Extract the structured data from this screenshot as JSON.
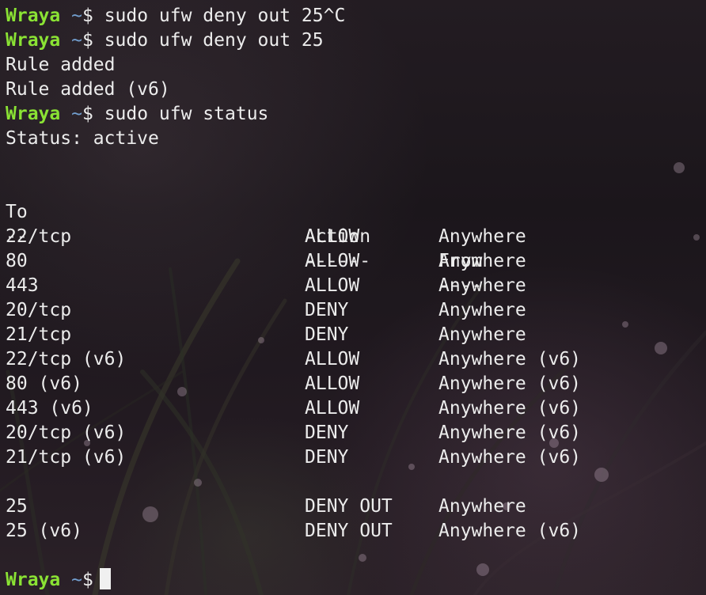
{
  "prompt": {
    "user": "Wraya",
    "path": "~",
    "symbol": "$"
  },
  "history": [
    {
      "type": "command",
      "text": "sudo ufw deny out 25^C"
    },
    {
      "type": "command",
      "text": "sudo ufw deny out 25"
    },
    {
      "type": "output",
      "text": "Rule added"
    },
    {
      "type": "output",
      "text": "Rule added (v6)"
    },
    {
      "type": "command",
      "text": "sudo ufw status"
    },
    {
      "type": "output",
      "text": "Status: active"
    }
  ],
  "table": {
    "headers": [
      "To",
      "Action",
      "From"
    ],
    "separators": [
      "--",
      "------",
      "----"
    ],
    "rules": [
      [
        "22/tcp",
        "ALLOW",
        "Anywhere"
      ],
      [
        "80",
        "ALLOW",
        "Anywhere"
      ],
      [
        "443",
        "ALLOW",
        "Anywhere"
      ],
      [
        "20/tcp",
        "DENY",
        "Anywhere"
      ],
      [
        "21/tcp",
        "DENY",
        "Anywhere"
      ],
      [
        "22/tcp (v6)",
        "ALLOW",
        "Anywhere (v6)"
      ],
      [
        "80 (v6)",
        "ALLOW",
        "Anywhere (v6)"
      ],
      [
        "443 (v6)",
        "ALLOW",
        "Anywhere (v6)"
      ],
      [
        "20/tcp (v6)",
        "DENY",
        "Anywhere (v6)"
      ],
      [
        "21/tcp (v6)",
        "DENY",
        "Anywhere (v6)"
      ]
    ],
    "out_rules": [
      [
        "25",
        "DENY OUT",
        "Anywhere"
      ],
      [
        "25 (v6)",
        "DENY OUT",
        "Anywhere (v6)"
      ]
    ]
  },
  "colors": {
    "user": "#8ae234",
    "path": "#729fcf",
    "text": "#ececec"
  }
}
